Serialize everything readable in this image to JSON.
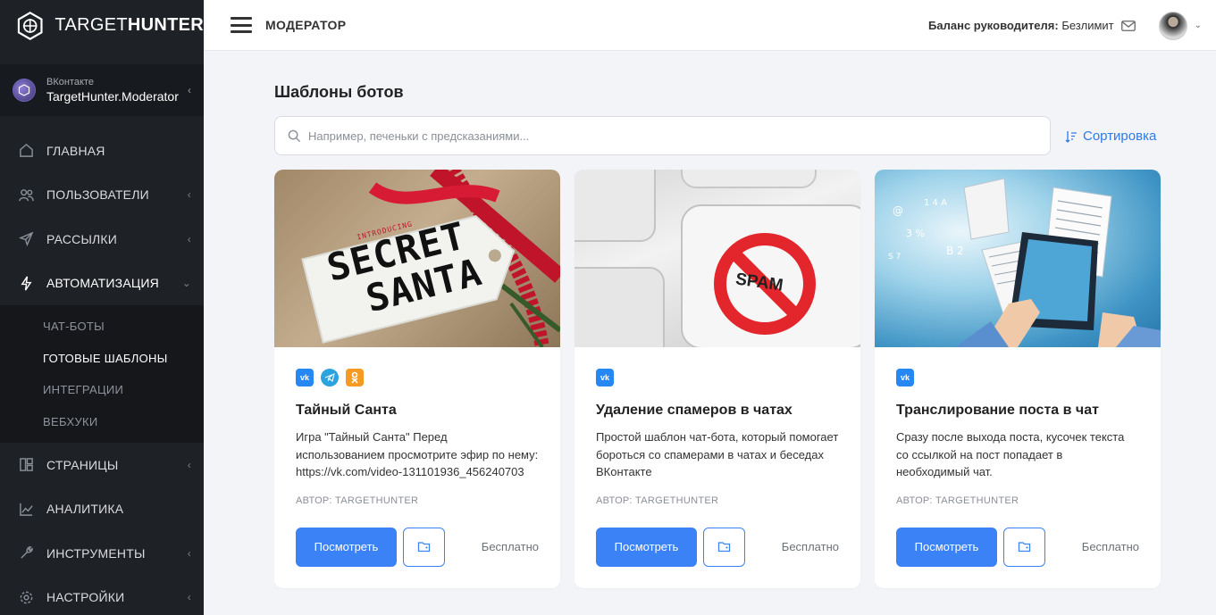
{
  "app": {
    "logo_light": "TARGET",
    "logo_bold": "HUNTER"
  },
  "account": {
    "network": "ВКонтакте",
    "name": "TargetHunter.Moderator"
  },
  "nav": {
    "items": [
      {
        "label": "ГЛАВНАЯ",
        "icon": "home-icon"
      },
      {
        "label": "ПОЛЬЗОВАТЕЛИ",
        "icon": "users-icon"
      },
      {
        "label": "РАССЫЛКИ",
        "icon": "send-icon"
      },
      {
        "label": "АВТОМАТИЗАЦИЯ",
        "icon": "lightning-icon"
      },
      {
        "label": "СТРАНИЦЫ",
        "icon": "pages-icon"
      },
      {
        "label": "АНАЛИТИКА",
        "icon": "chart-icon"
      },
      {
        "label": "ИНСТРУМЕНТЫ",
        "icon": "wrench-icon"
      },
      {
        "label": "НАСТРОЙКИ",
        "icon": "gear-icon"
      }
    ],
    "sub_items": [
      "ЧАТ-БОТЫ",
      "ГОТОВЫЕ ШАБЛОНЫ",
      "ИНТЕГРАЦИИ",
      "ВЕБХУКИ"
    ]
  },
  "header": {
    "title": "МОДЕРАТОР",
    "balance_label": "Баланс руководителя:",
    "balance_value": "Безлимит"
  },
  "main": {
    "title": "Шаблоны ботов",
    "search_placeholder": "Например, печеньки с предсказаниями...",
    "sort_label": "Сортировка"
  },
  "cards": [
    {
      "image_text_small": "INTRODUCING",
      "image_text_1": "SECRET",
      "image_text_2": "SANTA",
      "platforms": [
        "vk",
        "telegram",
        "ok"
      ],
      "title": "Тайный Санта",
      "desc": "Игра \"Тайный Санта\" Перед использованием просмотрите эфир по нему: https://vk.com/video-131101936_456240703",
      "author": "АВТОР: TARGETHUNTER",
      "view_label": "Посмотреть",
      "price": "Бесплатно"
    },
    {
      "image_text": "SPAM",
      "platforms": [
        "vk"
      ],
      "title": "Удаление спамеров в чатах",
      "desc": "Простой шаблон чат-бота, который помогает бороться со спамерами в чатах и беседах ВКонтакте",
      "author": "АВТОР: TARGETHUNTER",
      "view_label": "Посмотреть",
      "price": "Бесплатно"
    },
    {
      "platforms": [
        "vk"
      ],
      "title": "Транслирование поста в чат",
      "desc": "Сразу после выхода поста, кусочек текста со ссылкой на пост попадает в необходимый чат.",
      "author": "АВТОР: TARGETHUNTER",
      "view_label": "Посмотреть",
      "price": "Бесплатно"
    }
  ],
  "colors": {
    "sidebar": "#1e2126",
    "accent": "#3b82f6",
    "link": "#2f7ae5"
  }
}
